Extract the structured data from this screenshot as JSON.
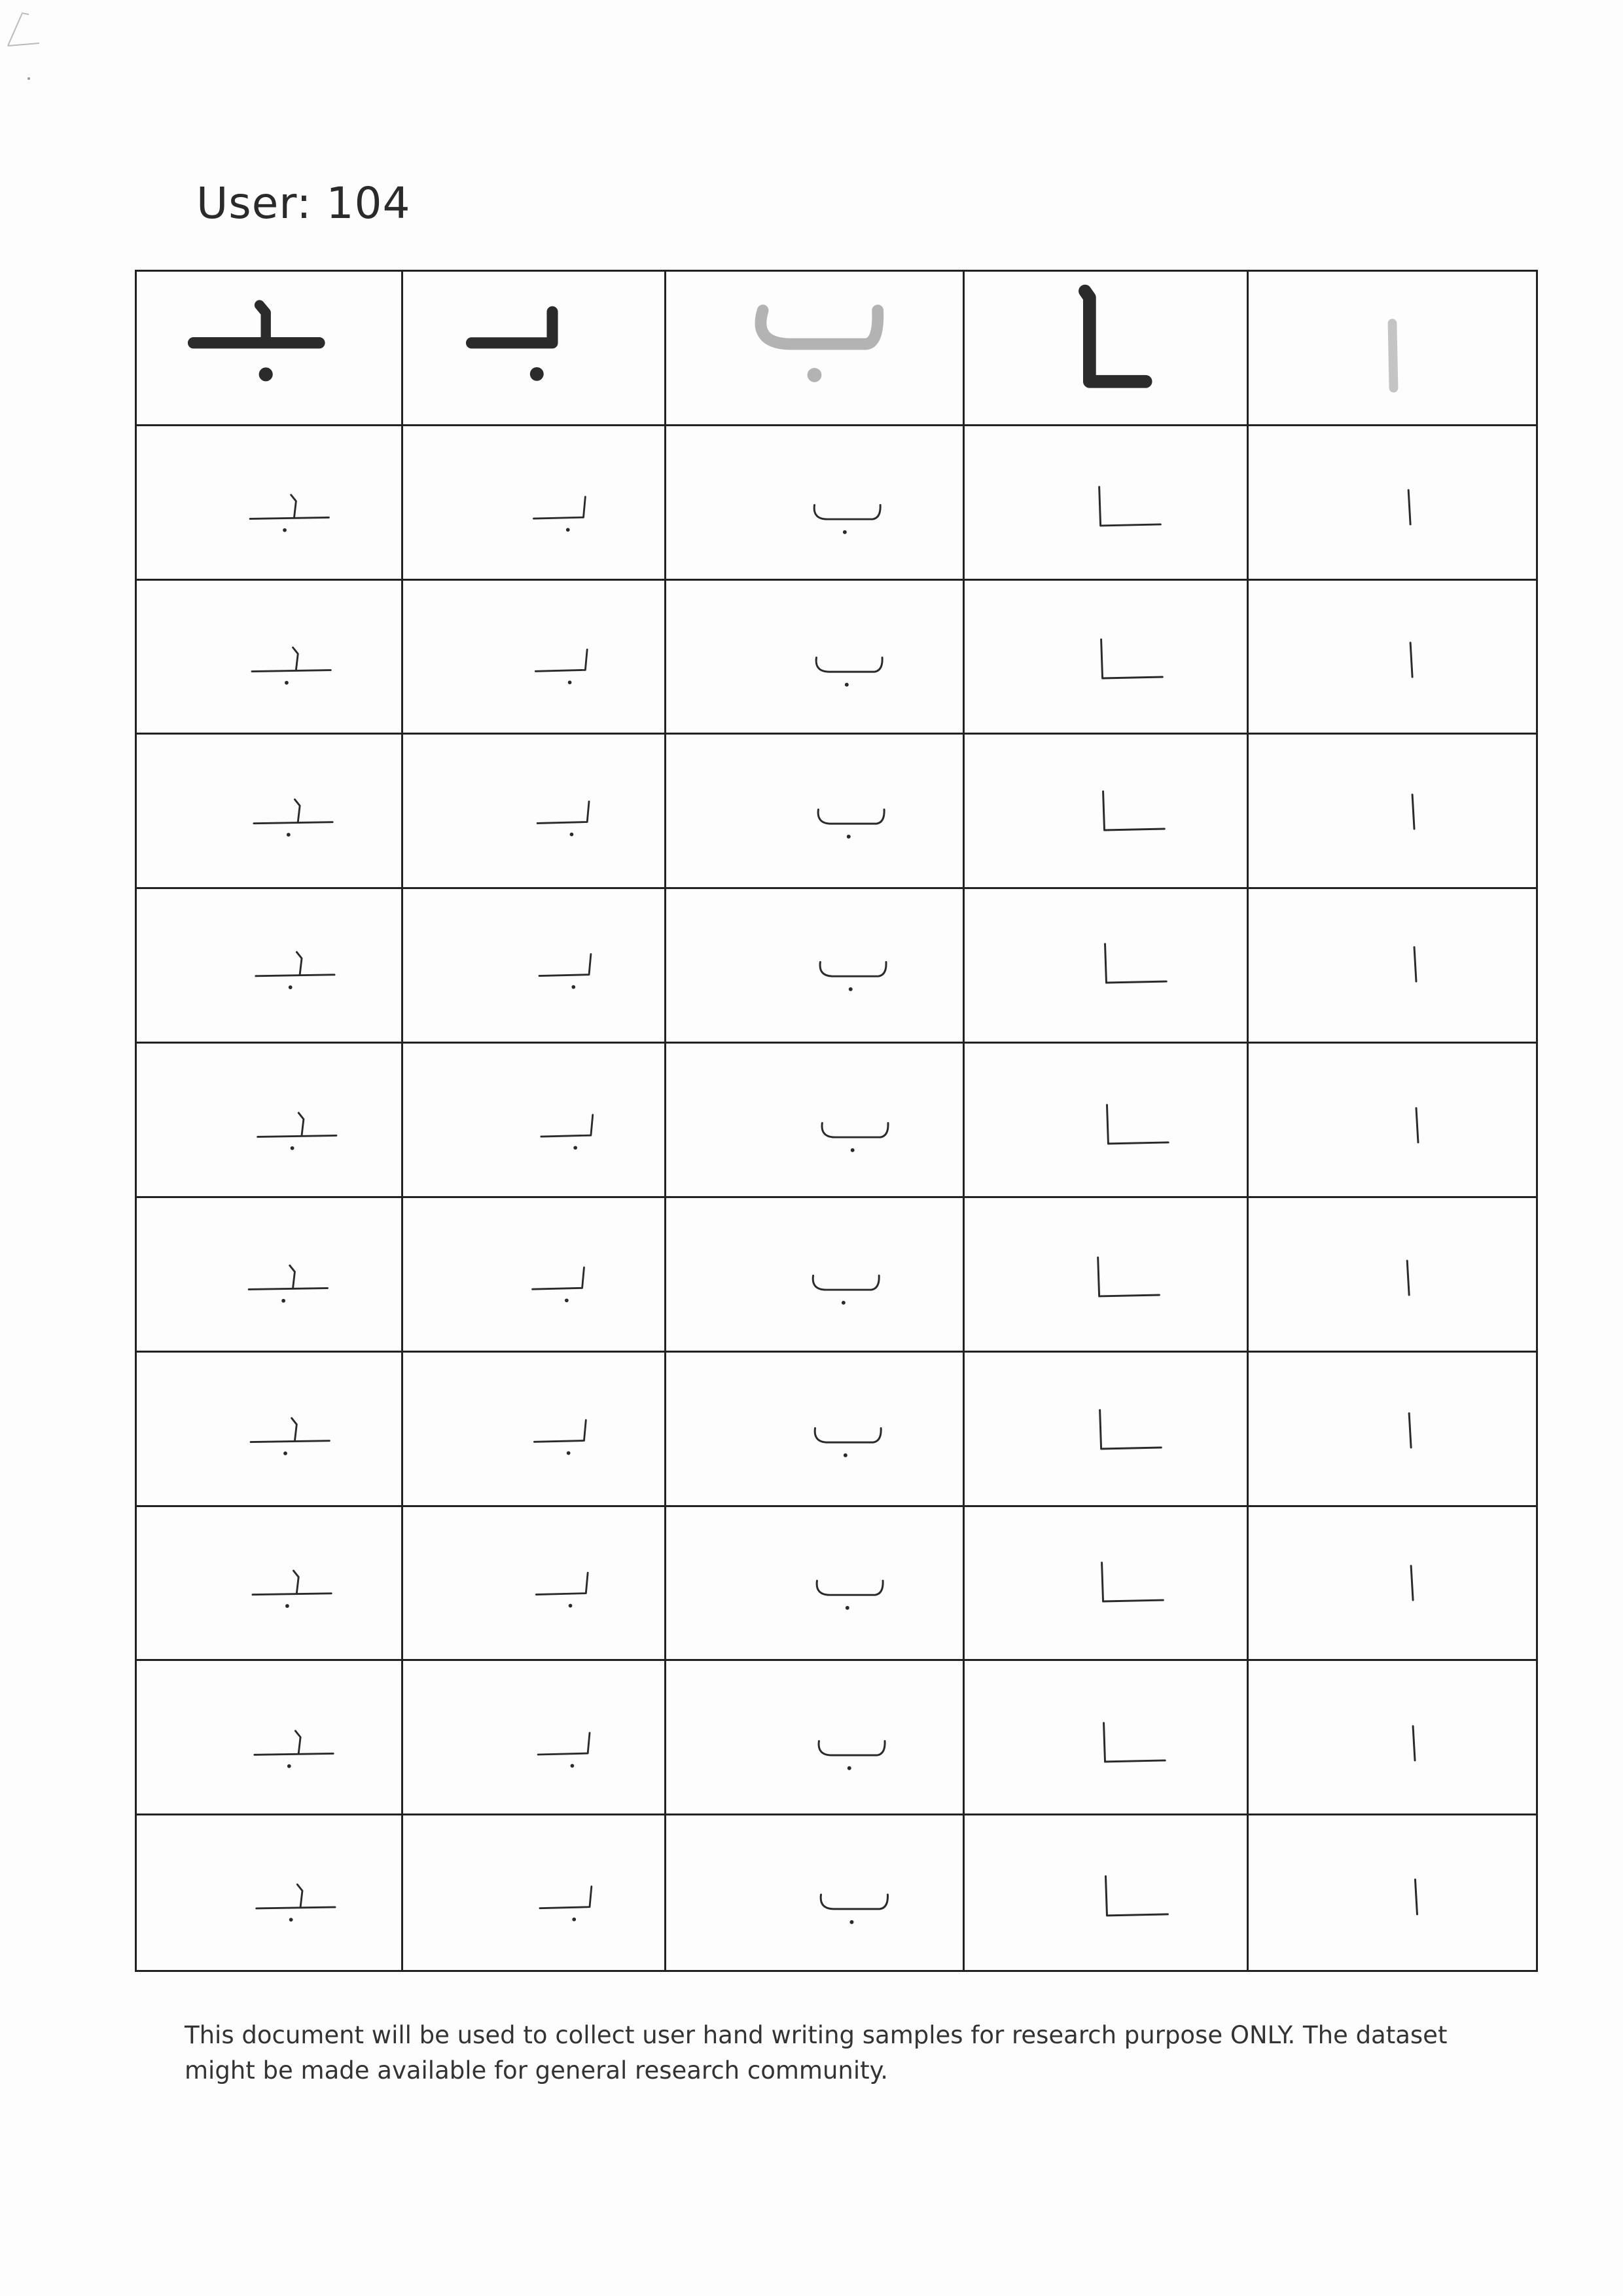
{
  "header": {
    "user_label": "User: 104"
  },
  "worksheet": {
    "columns": [
      {
        "form": "medial",
        "reference_glyph": "ـبـ",
        "reference_color": "#2b2b2b"
      },
      {
        "form": "initial",
        "reference_glyph": "بـ",
        "reference_color": "#2b2b2b"
      },
      {
        "form": "isolated",
        "reference_glyph": "ب",
        "reference_color": "#b3b3b3"
      },
      {
        "form": "final",
        "reference_glyph": "ـا",
        "reference_color": "#2b2b2b"
      },
      {
        "form": "isolated",
        "reference_glyph": "ا",
        "reference_color": "#c4c4c4"
      }
    ],
    "sample_rows": 10
  },
  "footer": {
    "notice": "This document will be used to collect user hand writing samples for research purpose ONLY. The dataset might be made available for general research community."
  }
}
